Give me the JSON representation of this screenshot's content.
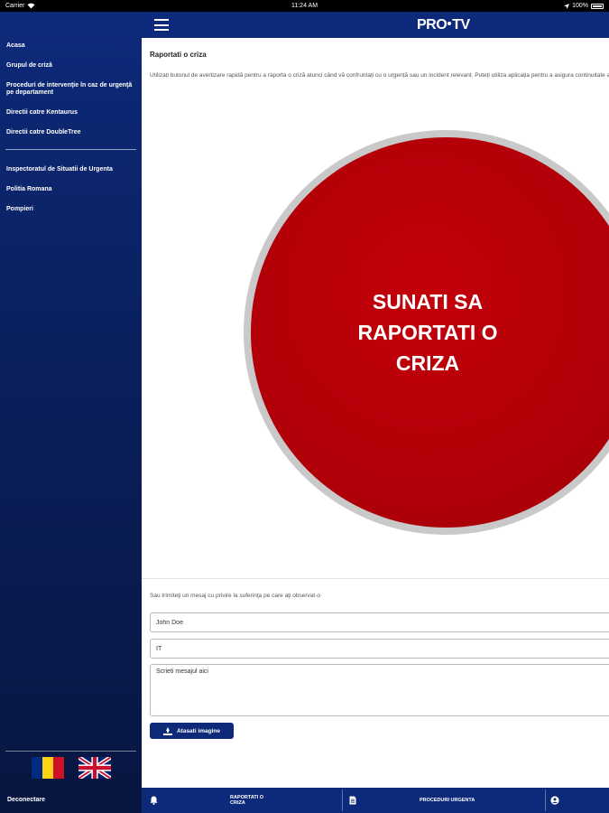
{
  "status_bar": {
    "carrier": "Carrier",
    "time": "11:24 AM",
    "battery": "100%"
  },
  "sidebar": {
    "group1": [
      {
        "label": "Acasa"
      },
      {
        "label": "Grupul de criză"
      },
      {
        "label": "Proceduri de intervenţie în caz de urgenţă pe departament"
      },
      {
        "label": "Directii catre Kentaurus"
      },
      {
        "label": "Directii catre DoubleTree"
      }
    ],
    "group2": [
      {
        "label": "Inspectoratul de Situatii de Urgenta"
      },
      {
        "label": "Politia Romana"
      },
      {
        "label": "Pompieri"
      }
    ],
    "logout": "Deconectare",
    "flag_colors": {
      "ro": [
        "#002b7f",
        "#fcd116",
        "#ce1126"
      ]
    }
  },
  "topbar": {
    "logo_left": "PRO",
    "logo_right": "TV"
  },
  "main": {
    "title": "Raportati o criza",
    "intro": "Utilizați butonul de avertizare rapidă pentru a raporta o criză atunci când vă confruntați cu o urgență sau un incident relevant. Puteți utiliza aplicația pentru a asigura continuitate al afacerii.",
    "crisis_button": "SUNATI SA RAPORTATI O CRIZA",
    "message_label": "Sau trimiteţi un mesaj cu privire la suferinţa pe care aţi observat-o",
    "name_value": "John Doe",
    "department_value": "IT",
    "message_placeholder": "Scrieti mesajul aici",
    "attach_label": "Atasati imagine"
  },
  "bottom_nav": {
    "report_label": "RAPORTATI O CRIZA",
    "procedures_label": "PROCEDURI URGENTA"
  },
  "colors": {
    "brand_blue": "#0d2a7a",
    "crisis_red": "#b20008"
  }
}
